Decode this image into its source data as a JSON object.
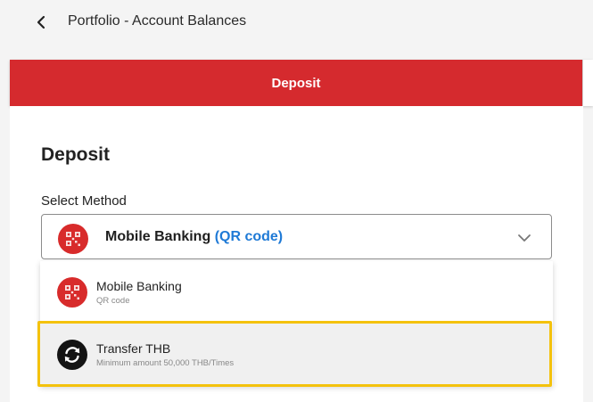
{
  "header": {
    "title": "Portfolio - Account Balances"
  },
  "tabs": {
    "deposit_label": "Deposit"
  },
  "main": {
    "section_title": "Deposit",
    "method_label": "Select Method"
  },
  "select": {
    "selected_main": "Mobile Banking",
    "selected_sub": "(QR code)"
  },
  "options": [
    {
      "title": "Mobile Banking",
      "subtitle": "QR code",
      "icon": "qr-code-icon"
    },
    {
      "title": "Transfer THB",
      "subtitle": "Minimum amount 50,000 THB/Times",
      "icon": "transfer-icon"
    }
  ],
  "colors": {
    "brand_red": "#d52a2e",
    "link_blue": "#1f7ad6",
    "highlight_yellow": "#f4c20d"
  }
}
